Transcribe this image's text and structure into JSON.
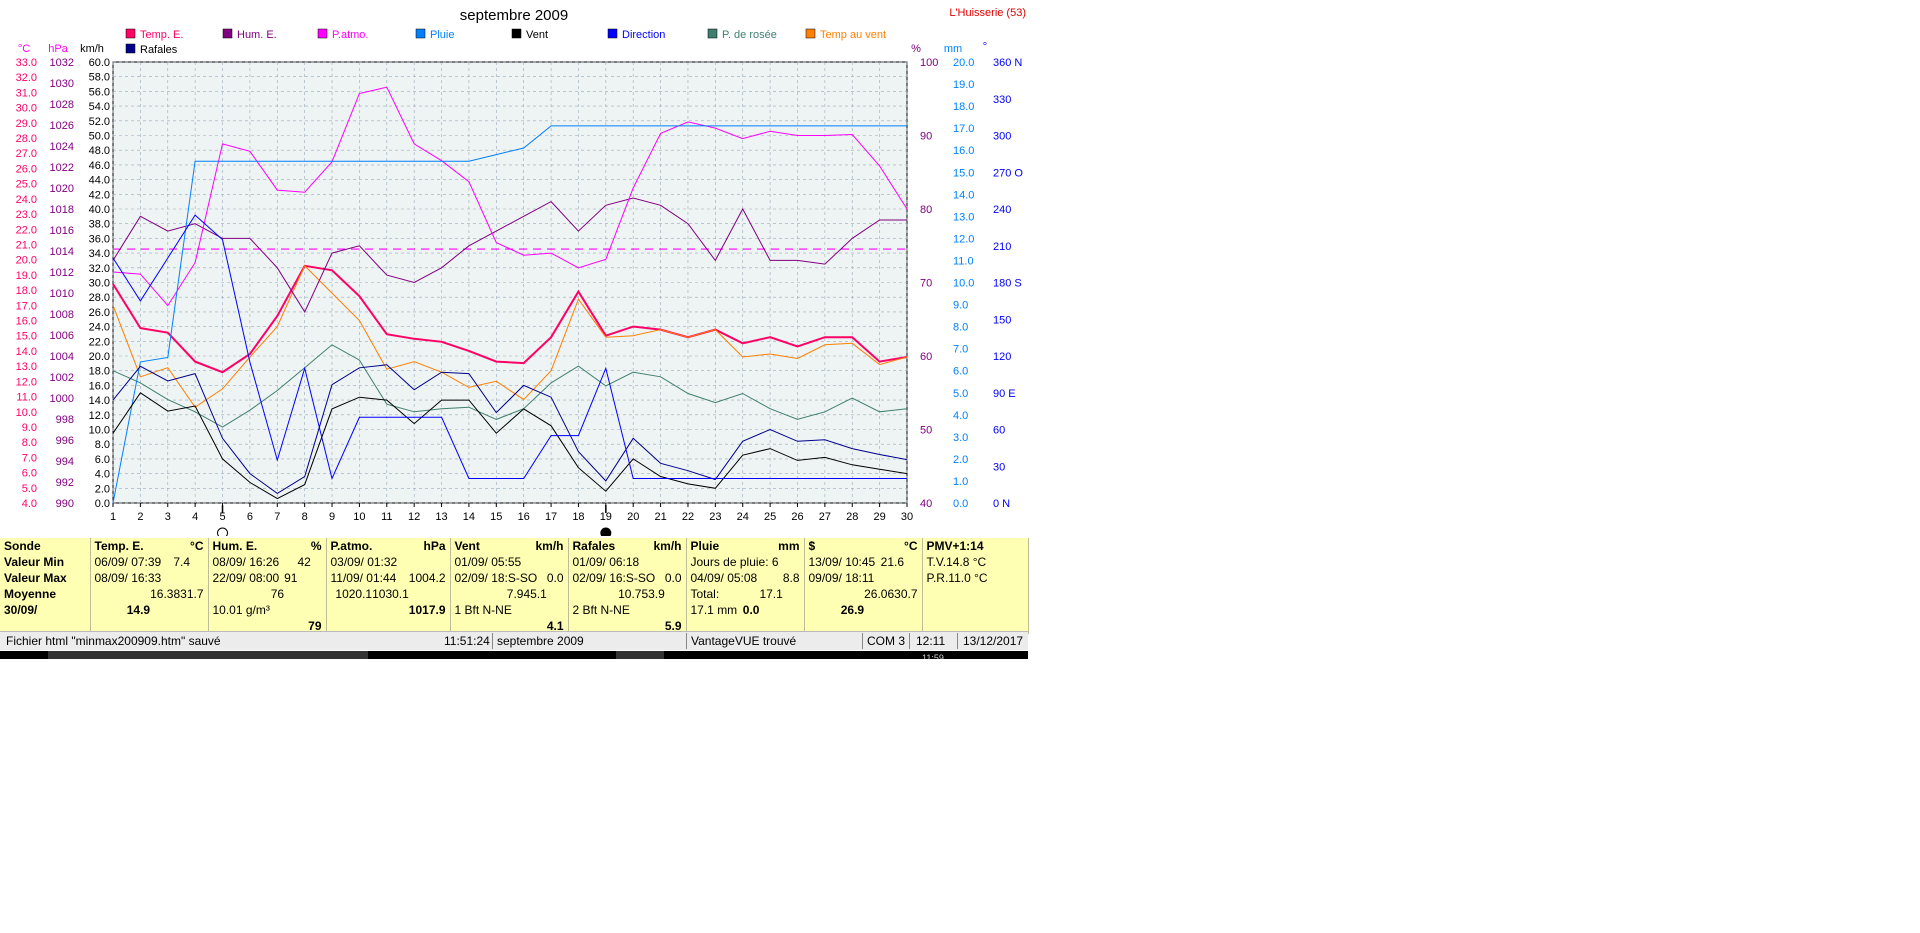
{
  "window": {
    "title": "septembre 2009",
    "station": "L'Huisserie (53)"
  },
  "colors": {
    "temp": "#ff0066",
    "hum": "#800080",
    "patmo": "#ff00ff",
    "pluie": "#0080ff",
    "vent": "#000000",
    "direction": "#0000ff",
    "rosee": "#3f7f6f",
    "tempvent": "#ff8000",
    "rafales": "#00008b",
    "panel": "#ffffb4"
  },
  "chart_data": {
    "type": "line",
    "title": "septembre 2009",
    "x": [
      1,
      2,
      3,
      4,
      5,
      6,
      7,
      8,
      9,
      10,
      11,
      12,
      13,
      14,
      15,
      16,
      17,
      18,
      19,
      20,
      21,
      22,
      23,
      24,
      25,
      26,
      27,
      28,
      29,
      30
    ],
    "grid": true,
    "legend_position": "top",
    "axes": {
      "temp": {
        "unit": "°C",
        "range": [
          4.0,
          33.0
        ],
        "ticks": [
          "33.0",
          "32.0",
          "31.0",
          "30.0",
          "29.0",
          "28.0",
          "27.0",
          "26.0",
          "25.0",
          "24.0",
          "23.0",
          "22.0",
          "21.0",
          "20.0",
          "19.0",
          "18.0",
          "17.0",
          "16.0",
          "15.0",
          "14.0",
          "13.0",
          "12.0",
          "11.0",
          "10.0",
          "9.0",
          "8.0",
          "7.0",
          "6.0",
          "5.0",
          "4.0"
        ]
      },
      "pressure": {
        "unit": "hPa",
        "range": [
          990,
          1032
        ],
        "ticks": [
          "1032",
          "1030",
          "1028",
          "1026",
          "1024",
          "1022",
          "1020",
          "1018",
          "1016",
          "1014",
          "1012",
          "1010",
          "1008",
          "1006",
          "1004",
          "1002",
          "1000",
          "998",
          "996",
          "994",
          "992",
          "990"
        ]
      },
      "wind": {
        "unit": "km/h",
        "range": [
          0.0,
          60.0
        ],
        "ticks": [
          "60.0",
          "58.0",
          "56.0",
          "54.0",
          "52.0",
          "50.0",
          "48.0",
          "46.0",
          "44.0",
          "42.0",
          "40.0",
          "38.0",
          "36.0",
          "34.0",
          "32.0",
          "30.0",
          "28.0",
          "26.0",
          "24.0",
          "22.0",
          "20.0",
          "18.0",
          "16.0",
          "14.0",
          "12.0",
          "10.0",
          "8.0",
          "6.0",
          "4.0",
          "2.0",
          "0.0"
        ]
      },
      "humidity": {
        "unit": "%",
        "range": [
          40,
          100
        ],
        "ticks": [
          "100",
          "90",
          "80",
          "70",
          "60",
          "50",
          "40"
        ]
      },
      "rain": {
        "unit": "mm",
        "range": [
          0.0,
          20.0
        ],
        "ticks": [
          "20.0",
          "19.0",
          "18.0",
          "17.0",
          "16.0",
          "15.0",
          "14.0",
          "13.0",
          "12.0",
          "11.0",
          "10.0",
          "9.0",
          "8.0",
          "7.0",
          "6.0",
          "5.0",
          "4.0",
          "3.0",
          "2.0",
          "1.0",
          "0.0"
        ]
      },
      "direction": {
        "unit": "°",
        "range": [
          0,
          360
        ],
        "ticks": [
          "360 N",
          "330",
          "300",
          "270 O",
          "240",
          "210",
          "180 S",
          "150",
          "120",
          "90  E",
          "60",
          "30",
          "0   N"
        ]
      }
    },
    "x_ticks": [
      "1",
      "2",
      "3",
      "4",
      "5",
      "6",
      "7",
      "8",
      "9",
      "10",
      "11",
      "12",
      "13",
      "14",
      "15",
      "16",
      "17",
      "18",
      "19",
      "20",
      "21",
      "22",
      "23",
      "24",
      "25",
      "26",
      "27",
      "28",
      "29",
      "30"
    ],
    "moon_markers": [
      {
        "day": 5,
        "type": "full"
      },
      {
        "day": 19,
        "type": "new"
      }
    ],
    "series": [
      {
        "name": "Temp. E.",
        "axis": "temp",
        "color": "#ff0066",
        "width": 2,
        "values": [
          18.4,
          15.5,
          15.2,
          13.3,
          12.6,
          13.8,
          16.3,
          19.6,
          19.3,
          17.6,
          15.1,
          14.8,
          14.6,
          14.0,
          13.3,
          13.2,
          14.9,
          17.9,
          15.0,
          15.6,
          15.4,
          14.9,
          15.4,
          14.5,
          14.9,
          14.3,
          14.9,
          14.9,
          13.3,
          13.6
        ]
      },
      {
        "name": "Temp au vent",
        "axis": "temp",
        "color": "#ff8000",
        "width": 1,
        "values": [
          17.0,
          12.3,
          12.9,
          10.3,
          11.5,
          13.6,
          15.6,
          19.6,
          17.8,
          16.0,
          12.8,
          13.3,
          12.6,
          11.6,
          12.0,
          10.8,
          12.7,
          17.4,
          14.9,
          15.0,
          15.4,
          14.9,
          15.4,
          13.6,
          13.8,
          13.5,
          14.4,
          14.5,
          13.1,
          13.6
        ]
      },
      {
        "name": "P. de rosée",
        "axis": "temp",
        "color": "#3f7f6f",
        "width": 1,
        "values": [
          12.7,
          11.9,
          10.8,
          10.0,
          9.0,
          10.1,
          11.4,
          12.9,
          14.4,
          13.4,
          10.5,
          10.0,
          10.2,
          10.3,
          9.5,
          10.2,
          11.9,
          13.0,
          11.7,
          12.6,
          12.3,
          11.2,
          10.6,
          11.2,
          10.2,
          9.5,
          10.0,
          10.9,
          10.0,
          10.2
        ]
      },
      {
        "name": "Hum. E.",
        "axis": "humidity",
        "color": "#800080",
        "width": 1,
        "values": [
          73,
          79,
          77,
          78,
          76,
          76,
          72,
          66,
          74,
          75,
          71,
          70,
          72,
          75,
          77,
          79,
          81,
          77,
          80.5,
          81.5,
          80.5,
          78,
          73,
          80,
          73,
          73,
          72.5,
          76,
          78.5,
          78.5
        ]
      },
      {
        "name": "P.atmo.",
        "axis": "pressure",
        "color": "#ff00ff",
        "width": 1,
        "values": [
          1012.0,
          1011.8,
          1008.8,
          1012.9,
          1024.2,
          1023.5,
          1019.8,
          1019.6,
          1022.5,
          1029.0,
          1029.6,
          1024.2,
          1022.6,
          1020.6,
          1014.8,
          1013.6,
          1013.8,
          1012.4,
          1013.2,
          1020.0,
          1025.2,
          1026.3,
          1025.7,
          1024.7,
          1025.4,
          1025.0,
          1025.0,
          1025.1,
          1022.1,
          1018.0
        ]
      },
      {
        "name": "Pluie",
        "axis": "rain",
        "color": "#0080ff",
        "width": 1,
        "values": [
          0.0,
          6.4,
          6.6,
          15.5,
          15.5,
          15.5,
          15.5,
          15.5,
          15.5,
          15.5,
          15.5,
          15.5,
          15.5,
          15.5,
          15.8,
          16.1,
          17.1,
          17.1,
          17.1,
          17.1,
          17.1,
          17.1,
          17.1,
          17.1,
          17.1,
          17.1,
          17.1,
          17.1,
          17.1,
          17.1
        ]
      },
      {
        "name": "Vent",
        "axis": "wind",
        "color": "#000000",
        "width": 1,
        "values": [
          9.5,
          15.0,
          12.5,
          13.2,
          6.0,
          2.8,
          0.6,
          2.5,
          12.8,
          14.4,
          14.0,
          10.8,
          14.0,
          14.0,
          9.5,
          12.8,
          10.5,
          4.8,
          1.6,
          6.0,
          3.6,
          2.6,
          2.0,
          6.5,
          7.4,
          5.8,
          6.2,
          5.2,
          4.6,
          4.0
        ]
      },
      {
        "name": "Rafales",
        "axis": "wind",
        "color": "#00008b",
        "width": 1,
        "values": [
          14.0,
          18.6,
          16.6,
          17.6,
          8.8,
          4.0,
          1.3,
          3.6,
          16.1,
          18.4,
          18.8,
          15.4,
          17.8,
          17.6,
          12.3,
          16.0,
          14.4,
          7.0,
          3.0,
          8.8,
          5.4,
          4.4,
          3.2,
          8.4,
          10.0,
          8.4,
          8.6,
          7.4,
          6.6,
          5.9
        ]
      },
      {
        "name": "Direction",
        "axis": "direction",
        "color": "#0000ff",
        "width": 1,
        "values": [
          200,
          165,
          200,
          235,
          215,
          115,
          35,
          110,
          20,
          70,
          70,
          70,
          70,
          20,
          20,
          20,
          55,
          55,
          110,
          20,
          20,
          20,
          20,
          20,
          20,
          20,
          20,
          20,
          20,
          20
        ]
      }
    ],
    "reference_lines": [
      {
        "axis": "temp",
        "value": 20.7,
        "color": "#ff00ff",
        "style": "dashed"
      }
    ],
    "legend": [
      {
        "label": "Temp. E.",
        "color": "#ff0066",
        "text_color": "#ff0066"
      },
      {
        "label": "Hum. E.",
        "color": "#800080",
        "text_color": "#800080"
      },
      {
        "label": "P.atmo.",
        "color": "#ff00ff",
        "text_color": "#ff00ff"
      },
      {
        "label": "Pluie",
        "color": "#0080ff",
        "text_color": "#0080ff"
      },
      {
        "label": "Vent",
        "color": "#000000",
        "text_color": "#000000"
      },
      {
        "label": "Direction",
        "color": "#0000ff",
        "text_color": "#0000ff"
      },
      {
        "label": "P. de rosée",
        "color": "#3f7f6f",
        "text_color": "#3f7f6f"
      },
      {
        "label": "Temp au vent",
        "color": "#ff8000",
        "text_color": "#ff8000"
      },
      {
        "label": "Rafales",
        "color": "#00008b",
        "text_color": "#000000"
      }
    ]
  },
  "stats": {
    "labels": {
      "title": "Sonde",
      "min": "Valeur Min",
      "max": "Valeur Max",
      "avg": "Moyenne",
      "date": "30/09/"
    },
    "temp": {
      "title": "Temp. E.",
      "unit": "°C",
      "min_date": "06/09/  07:39",
      "min": "7.4",
      "max_date": "08/09/  16:33",
      "max": "31.7",
      "avg": "16.38",
      "current": "14.9"
    },
    "hum": {
      "title": "Hum. E.",
      "unit": "%",
      "min_date": "08/09/  16:26",
      "min": "42",
      "max_date": "22/09/  08:00",
      "max": "91",
      "avg": "76",
      "extra": "10.01 g/m³",
      "current": "79"
    },
    "patmo": {
      "title": "P.atmo.",
      "unit": "hPa",
      "min_date": "03/09/  01:32",
      "min": "1004.2",
      "max_date": "11/09/  01:44",
      "max": "1030.1",
      "avg": "1020.1",
      "current": "1017.9"
    },
    "vent": {
      "title": "Vent",
      "unit": "km/h",
      "min_date": "01/09/  05:55",
      "min": "0.0",
      "max_date": "02/09/  18:S-SO",
      "max": "45.1",
      "avg": "7.9",
      "extra": "1 Bft N-NE",
      "current": "4.1"
    },
    "rafales": {
      "title": "Rafales",
      "unit": "km/h",
      "min_date": "01/09/  06:18",
      "min": "0.0",
      "max_date": "02/09/  16:S-SO",
      "max": "53.9",
      "avg": "10.7",
      "extra": "2 Bft N-NE",
      "current": "5.9"
    },
    "pluie": {
      "title": "Pluie",
      "unit": "mm",
      "row1": "Jours de pluie: 6",
      "max_date": "04/09/  05:08",
      "max": "8.8",
      "total_label": "Total:",
      "total": "17.1",
      "extra": "17.1 mm",
      "current": "0.0"
    },
    "s": {
      "title": "$",
      "unit": "°C",
      "min_date": "13/09/  10:45",
      "min": "21.6",
      "max_date": "09/09/  18:11",
      "max": "30.7",
      "avg": "26.06",
      "current": "26.9"
    },
    "pmv": {
      "title": "PMV+1:14",
      "tv": "T.V.14.8 °C",
      "pr": "P.R.11.0 °C"
    }
  },
  "statusbar": {
    "file": "Fichier html  \"minmax200909.htm\"  sauvé",
    "time": "11:51:24",
    "period": "septembre 2009",
    "device": "VantageVUE trouvé",
    "port": "COM 3",
    "clock": "12:11",
    "date": "13/12/2017"
  },
  "overflow_text": "11:59"
}
